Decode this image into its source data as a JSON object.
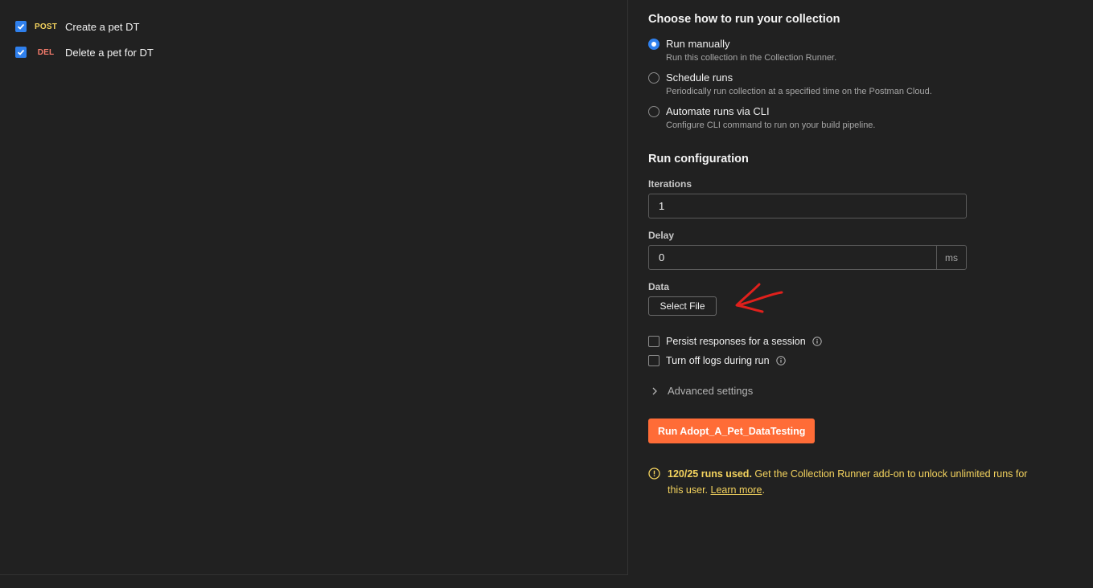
{
  "requests": [
    {
      "method": "POST",
      "name": "Create a pet DT",
      "checked": true
    },
    {
      "method": "DEL",
      "name": "Delete a pet for DT",
      "checked": true
    }
  ],
  "run_mode": {
    "title": "Choose how to run your collection",
    "options": [
      {
        "label": "Run manually",
        "description": "Run this collection in the Collection Runner.",
        "selected": true
      },
      {
        "label": "Schedule runs",
        "description": "Periodically run collection at a specified time on the Postman Cloud.",
        "selected": false
      },
      {
        "label": "Automate runs via CLI",
        "description": "Configure CLI command to run on your build pipeline.",
        "selected": false
      }
    ]
  },
  "config": {
    "title": "Run configuration",
    "iterations_label": "Iterations",
    "iterations_value": "1",
    "delay_label": "Delay",
    "delay_value": "0",
    "delay_unit": "ms",
    "data_label": "Data",
    "select_file_label": "Select File",
    "persist_label": "Persist responses for a session",
    "logs_label": "Turn off logs during run",
    "advanced_label": "Advanced settings"
  },
  "run_button_label": "Run Adopt_A_Pet_DataTesting",
  "warning": {
    "strong": "120/25 runs used.",
    "text": " Get the Collection Runner add-on to unlock unlimited runs for this user. ",
    "link": "Learn more",
    "tail": "."
  },
  "colors": {
    "accent_blue": "#2f80ed",
    "run_orange": "#ff6c37",
    "warning_yellow": "#f4d35e",
    "annotation_red": "#e0201c"
  }
}
